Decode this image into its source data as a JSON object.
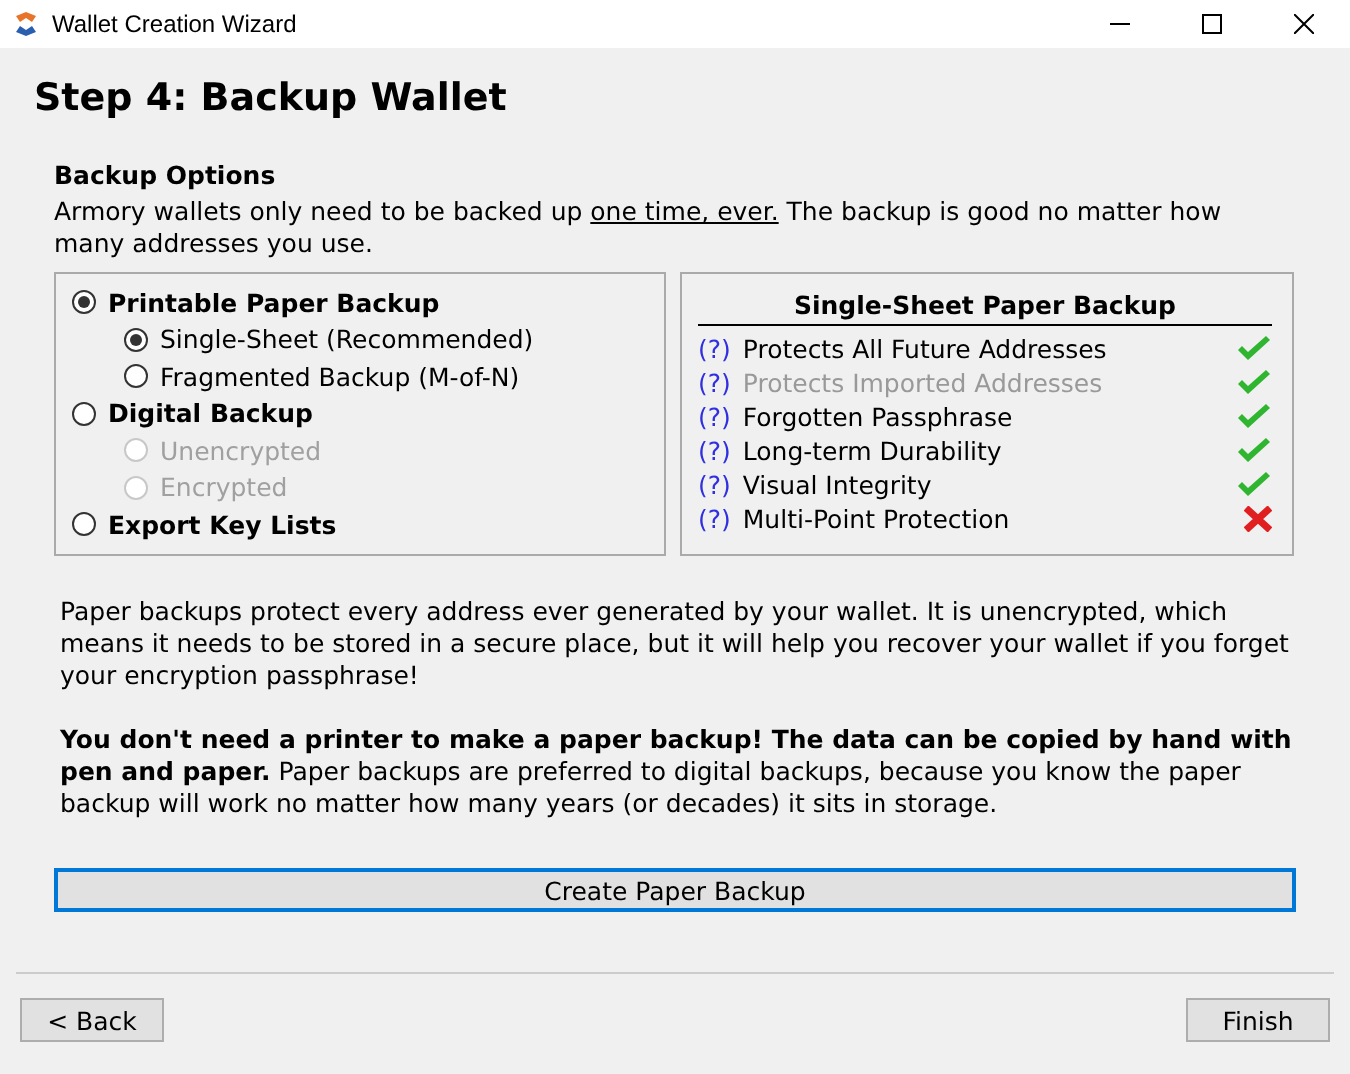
{
  "window": {
    "title": "Wallet Creation Wizard"
  },
  "heading": "Step 4: Backup Wallet",
  "section_title": "Backup Options",
  "intro": [
    {
      "text": "Armory wallets only need to be backed up ",
      "underlined": false
    },
    {
      "text": "one time, ever.",
      "underlined": true
    },
    {
      "text": " The backup is good no matter how many addresses you use.",
      "underlined": false
    }
  ],
  "options": [
    {
      "label": "Printable Paper Backup",
      "selected": true,
      "disabled": false,
      "children": [
        {
          "label": "Single-Sheet (Recommended)",
          "selected": true,
          "disabled": false
        },
        {
          "label": "Fragmented Backup (M-of-N)",
          "selected": false,
          "disabled": false
        }
      ]
    },
    {
      "label": "Digital Backup",
      "selected": false,
      "disabled": false,
      "children": [
        {
          "label": "Unencrypted",
          "selected": false,
          "disabled": true
        },
        {
          "label": "Encrypted",
          "selected": false,
          "disabled": true
        }
      ]
    },
    {
      "label": "Export Key Lists",
      "selected": false,
      "disabled": false
    }
  ],
  "features": {
    "title": "Single-Sheet Paper Backup",
    "items": [
      {
        "help": "(?)",
        "label": "Protects All Future Addresses",
        "disabled": false,
        "supported": true
      },
      {
        "help": "(?)",
        "label": "Protects Imported Addresses",
        "disabled": true,
        "supported": true
      },
      {
        "help": "(?)",
        "label": "Forgotten Passphrase",
        "disabled": false,
        "supported": true
      },
      {
        "help": "(?)",
        "label": "Long-term Durability",
        "disabled": false,
        "supported": true
      },
      {
        "help": "(?)",
        "label": "Visual Integrity",
        "disabled": false,
        "supported": true
      },
      {
        "help": "(?)",
        "label": "Multi-Point Protection",
        "disabled": false,
        "supported": false
      }
    ]
  },
  "paragraphs": [
    "Paper backups protect every address ever generated by your wallet. It is unencrypted, which means it needs to be stored in a secure place, but it will help you recover your wallet if you forget your encryption passphrase!",
    "**You don't need a printer to make a paper backup! The data can be copied by hand with pen and paper.** Paper backups are preferred to digital backups, because you know the paper backup will work no matter how many years (or decades) it sits in storage."
  ],
  "action_button": "Create Paper Backup",
  "buttons": {
    "back": "< Back",
    "finish": "Finish"
  }
}
